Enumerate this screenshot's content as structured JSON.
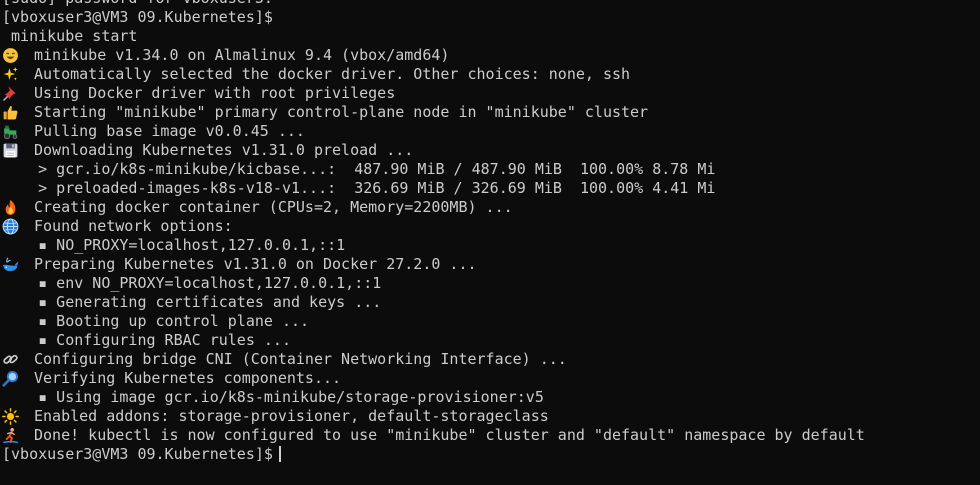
{
  "terminal": {
    "lines": [
      {
        "text": "[sudo] password for vboxuser3:"
      },
      {
        "text": "[vboxuser3@VM3 09.Kubernetes]$"
      },
      {
        "text": " minikube start"
      },
      {
        "icon": "smiley-face-icon",
        "text": "minikube v1.34.0 on Almalinux 9.4 (vbox/amd64)"
      },
      {
        "icon": "sparkles-icon",
        "text": "Automatically selected the docker driver. Other choices: none, ssh"
      },
      {
        "icon": "pushpin-icon",
        "text": "Using Docker driver with root privileges"
      },
      {
        "icon": "thumbs-up-icon",
        "text": "Starting \"minikube\" primary control-plane node in \"minikube\" cluster"
      },
      {
        "icon": "tractor-icon",
        "text": "Pulling base image v0.0.45 ..."
      },
      {
        "icon": "floppy-disk-icon",
        "text": "Downloading Kubernetes v1.31.0 preload ..."
      },
      {
        "text": "    > gcr.io/k8s-minikube/kicbase...:  487.90 MiB / 487.90 MiB  100.00% 8.78 Mi"
      },
      {
        "text": "    > preloaded-images-k8s-v18-v1...:  326.69 MiB / 326.69 MiB  100.00% 4.41 Mi"
      },
      {
        "icon": "fire-icon",
        "text": "Creating docker container (CPUs=2, Memory=2200MB) ..."
      },
      {
        "icon": "globe-icon",
        "text": "Found network options:"
      },
      {
        "text": "    ▪ NO_PROXY=localhost,127.0.0.1,::1"
      },
      {
        "icon": "whale-icon",
        "text": "Preparing Kubernetes v1.31.0 on Docker 27.2.0 ..."
      },
      {
        "text": "    ▪ env NO_PROXY=localhost,127.0.0.1,::1"
      },
      {
        "text": "    ▪ Generating certificates and keys ..."
      },
      {
        "text": "    ▪ Booting up control plane ..."
      },
      {
        "text": "    ▪ Configuring RBAC rules ..."
      },
      {
        "icon": "link-icon",
        "text": "Configuring bridge CNI (Container Networking Interface) ..."
      },
      {
        "icon": "magnifying-glass-icon",
        "text": "Verifying Kubernetes components..."
      },
      {
        "text": "    ▪ Using image gcr.io/k8s-minikube/storage-provisioner:v5"
      },
      {
        "icon": "sun-icon",
        "text": "Enabled addons: storage-provisioner, default-storageclass"
      },
      {
        "icon": "surfer-icon",
        "text": "Done! kubectl is now configured to use \"minikube\" cluster and \"default\" namespace by default"
      },
      {
        "text": "[vboxuser3@VM3 09.Kubernetes]$",
        "cursor": true
      }
    ]
  },
  "colors": {
    "background": "#0c0c0c",
    "foreground": "#cccccc"
  }
}
